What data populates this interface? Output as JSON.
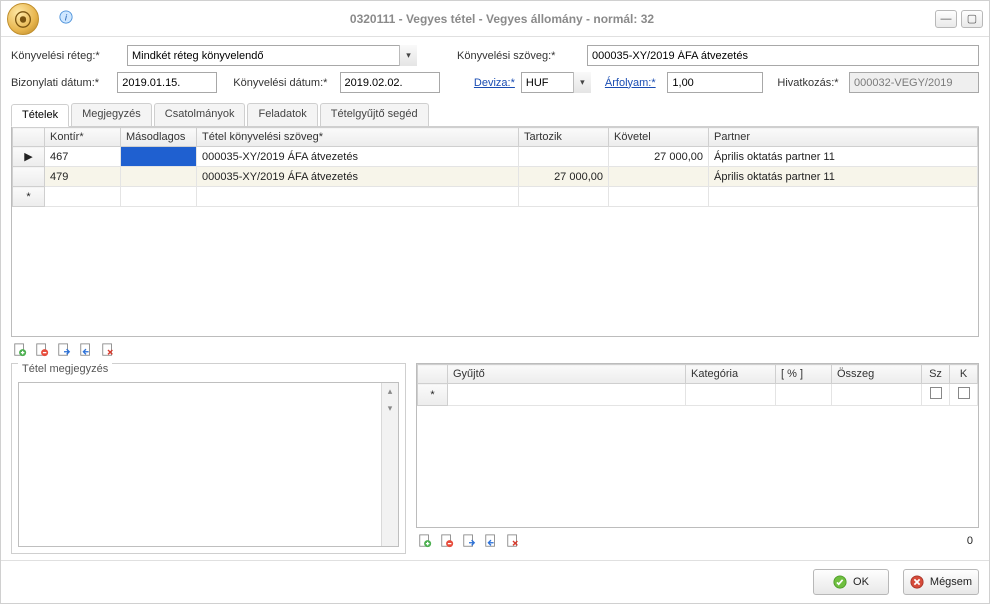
{
  "window": {
    "title": "0320111 - Vegyes tétel - Vegyes állomány - normál: 32"
  },
  "form": {
    "reteg_label": "Könyvelési réteg:*",
    "reteg_value": "Mindkét réteg könyvelendő",
    "bizdatum_label": "Bizonylati dátum:*",
    "bizdatum_value": "2019.01.15.",
    "konyvdatum_label": "Könyvelési dátum:*",
    "konyvdatum_value": "2019.02.02.",
    "szoveg_label": "Könyvelési szöveg:*",
    "szoveg_value": "000035-XY/2019 ÁFA átvezetés",
    "deviza_label": "Deviza:*",
    "deviza_value": "HUF",
    "arfolyam_label": "Árfolyam:*",
    "arfolyam_value": "1,00",
    "hivatkozas_label": "Hivatkozás:*",
    "hivatkozas_value": "000032-VEGY/2019"
  },
  "tabs": [
    "Tételek",
    "Megjegyzés",
    "Csatolmányok",
    "Feladatok",
    "Tételgyűjtő segéd"
  ],
  "maingrid": {
    "headers": {
      "kontir": "Kontír*",
      "masodlagos": "Másodlagos",
      "szoveg": "Tétel könyvelési szöveg*",
      "tartozik": "Tartozik",
      "kovetel": "Követel",
      "partner": "Partner"
    },
    "rows": [
      {
        "marker": "▶",
        "kontir": "467",
        "masodlagos_hl": true,
        "szoveg": "000035-XY/2019 ÁFA átvezetés",
        "tartozik": "",
        "kovetel": "27 000,00",
        "partner": "Április oktatás partner 11"
      },
      {
        "marker": "",
        "kontir": "479",
        "szoveg": "000035-XY/2019 ÁFA átvezetés",
        "tartozik": "27 000,00",
        "kovetel": "",
        "partner": "Április oktatás partner 11",
        "alt": true
      },
      {
        "marker": "*",
        "kontir": "",
        "szoveg": "",
        "tartozik": "",
        "kovetel": "",
        "partner": ""
      }
    ]
  },
  "notes": {
    "legend": "Tétel megjegyzés"
  },
  "subgrid": {
    "headers": {
      "gyujto": "Gyűjtő",
      "kategoria": "Kategória",
      "pct": "[ % ]",
      "osszeg": "Összeg",
      "sz": "Sz",
      "k": "K"
    },
    "newmarker": "*",
    "counter": "0"
  },
  "buttons": {
    "ok": "OK",
    "cancel": "Mégsem"
  }
}
